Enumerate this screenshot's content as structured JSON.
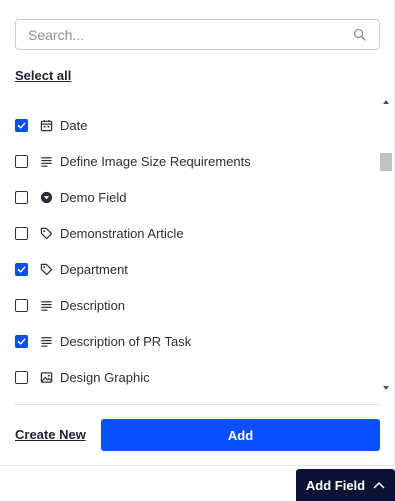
{
  "search": {
    "placeholder": "Search...",
    "icon": "search-icon"
  },
  "select_all_label": "Select all",
  "fields": [
    {
      "label": "Date",
      "checked": true,
      "icon": "calendar-icon"
    },
    {
      "label": "Define Image Size Requirements",
      "checked": false,
      "icon": "text-lines-icon"
    },
    {
      "label": "Demo Field",
      "checked": false,
      "icon": "dropdown-circle-icon"
    },
    {
      "label": "Demonstration Article",
      "checked": false,
      "icon": "tag-icon"
    },
    {
      "label": "Department",
      "checked": true,
      "icon": "tag-icon"
    },
    {
      "label": "Description",
      "checked": false,
      "icon": "text-lines-icon"
    },
    {
      "label": "Description of PR Task",
      "checked": true,
      "icon": "text-lines-icon"
    },
    {
      "label": "Design Graphic",
      "checked": false,
      "icon": "image-icon"
    }
  ],
  "footer": {
    "create_new_label": "Create New",
    "add_label": "Add"
  },
  "add_field_button": {
    "label": "Add Field",
    "icon": "chevron-up-icon"
  },
  "colors": {
    "accent": "#0a50ff",
    "dark_button": "#0c1236",
    "checkbox_checked": "#0a50f0"
  }
}
